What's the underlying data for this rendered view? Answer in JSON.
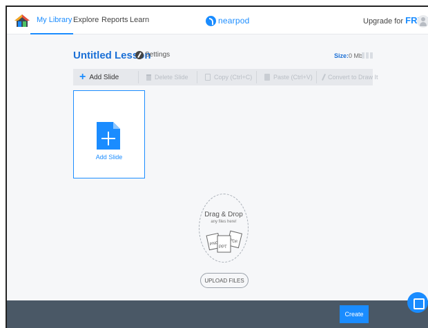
{
  "nav": {
    "items": [
      "My Library",
      "Explore",
      "Reports",
      "Learn"
    ],
    "active": "My Library",
    "logo_text": "nearpod",
    "upgrade_text": "Upgrade for",
    "upgrade_highlight": "FREE",
    "accent_color": "#1a8cff"
  },
  "lesson": {
    "title": "Untitled Lesson",
    "settings_label": "Settings",
    "size_label": "Size:",
    "size_value": "0 Mb"
  },
  "toolbar": {
    "add_slide": "Add Slide",
    "delete_slide": "Delete Slide",
    "copy": "Copy (Ctrl+C)",
    "paste": "Paste (Ctrl+V)",
    "convert": "Convert to Draw It"
  },
  "slide_card": {
    "label": "Add Slide"
  },
  "drop_zone": {
    "title": "Drag & Drop",
    "subtitle": "any files here!",
    "file_types": [
      "PNG",
      "PPT",
      "PDF"
    ],
    "upload_label": "UPLOAD FILES"
  },
  "footer": {
    "create_label": "Create"
  }
}
